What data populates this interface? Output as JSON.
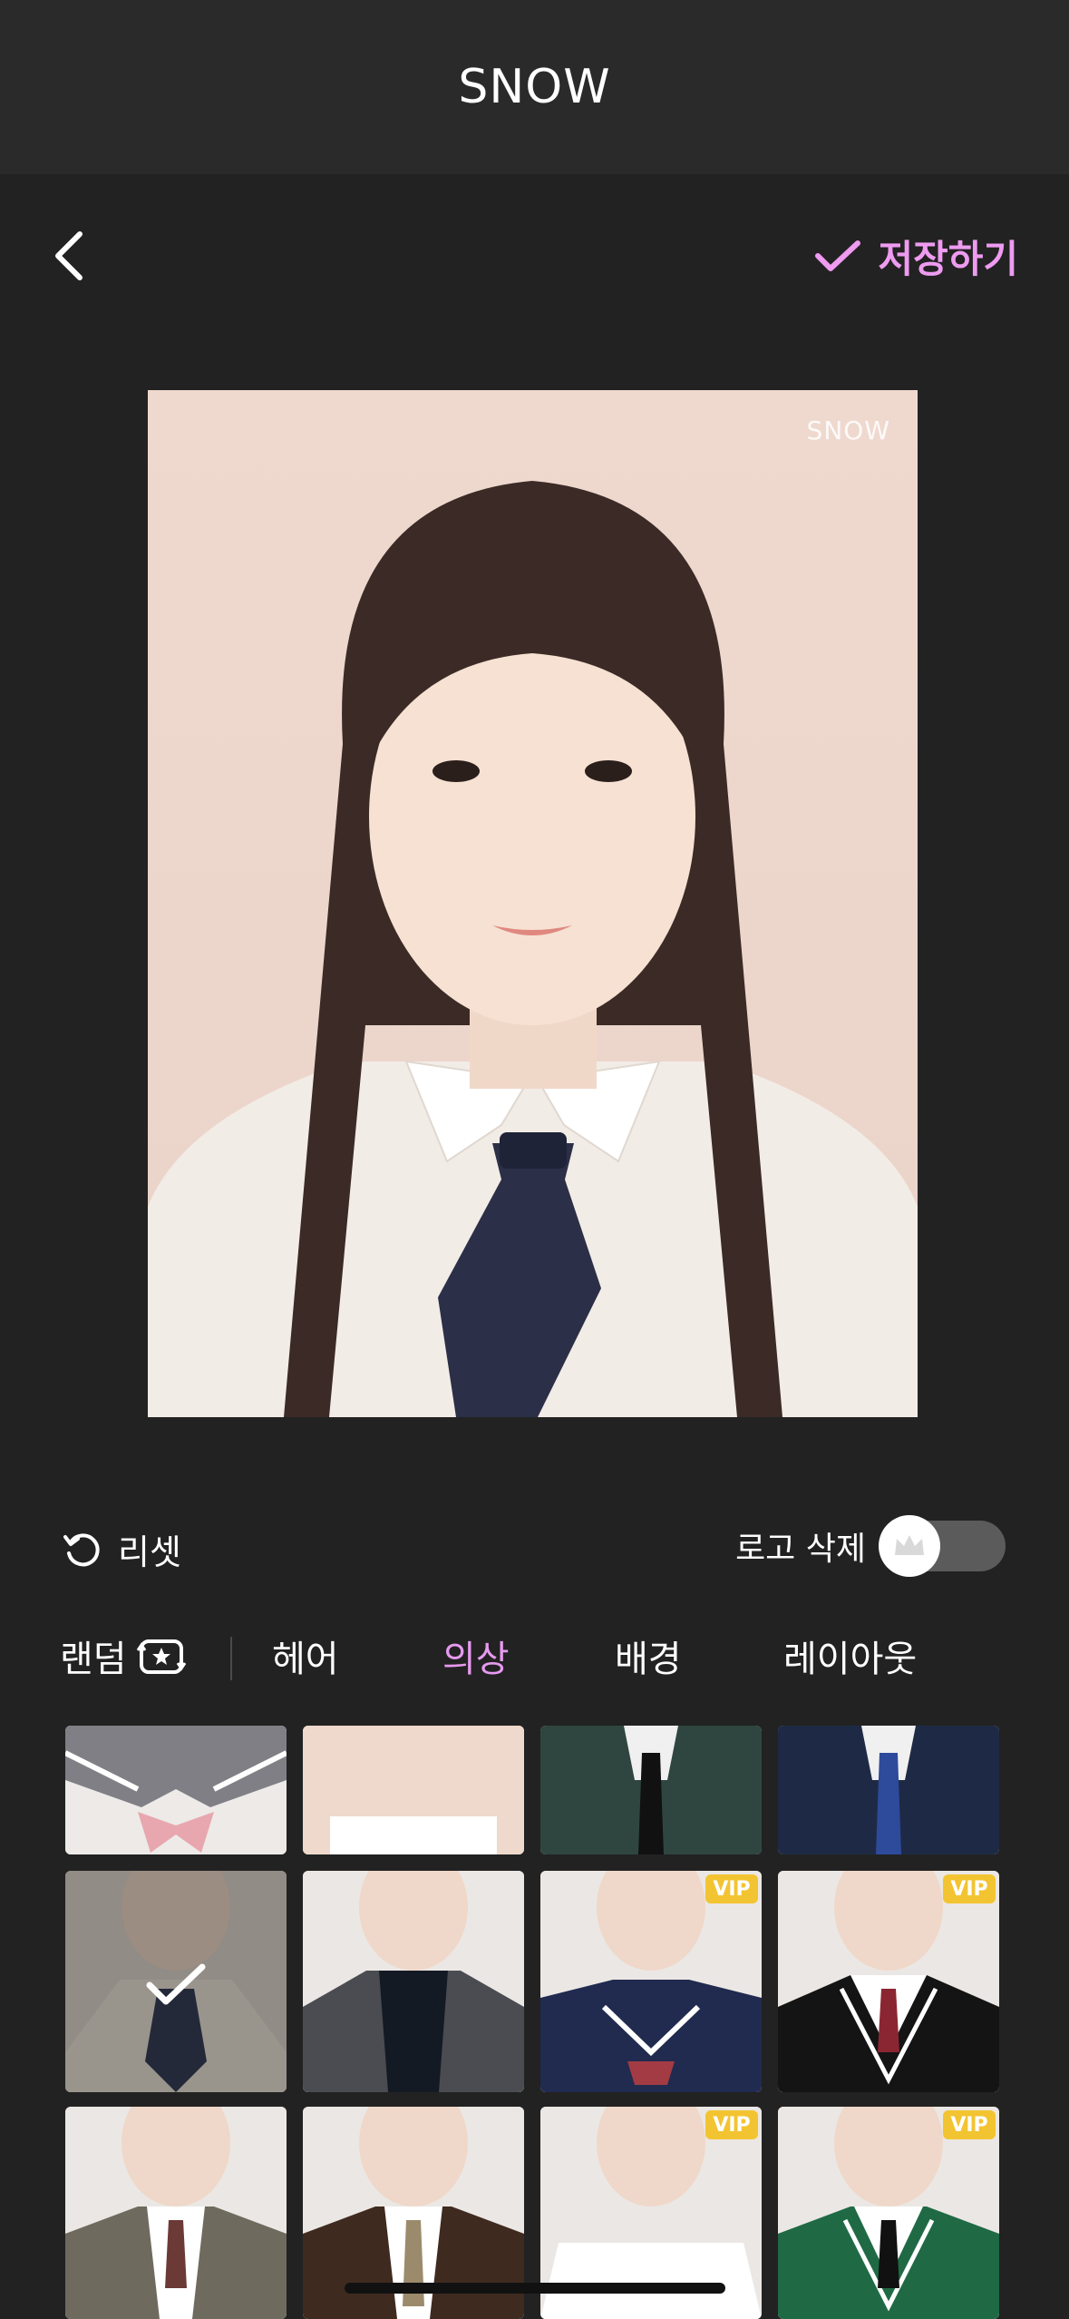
{
  "app": {
    "title": "SNOW"
  },
  "header": {
    "save_label": "저장하기"
  },
  "photo": {
    "watermark": "SNOW"
  },
  "controls": {
    "reset_label": "리셋",
    "logo_remove_label": "로고 삭제",
    "logo_remove_on": false
  },
  "tabs": {
    "random": "랜덤",
    "items": [
      {
        "label": "헤어",
        "active": false
      },
      {
        "label": "의상",
        "active": true
      },
      {
        "label": "배경",
        "active": false
      },
      {
        "label": "레이아웃",
        "active": false
      }
    ]
  },
  "outfits": {
    "vip_label": "VIP",
    "items": [
      {
        "name": "sailor-pink-bow",
        "vip": false,
        "selected": false
      },
      {
        "name": "square-neck",
        "vip": false,
        "selected": false
      },
      {
        "name": "army-uniform",
        "vip": false,
        "selected": false
      },
      {
        "name": "navy-uniform",
        "vip": false,
        "selected": false
      },
      {
        "name": "cream-jabot",
        "vip": false,
        "selected": true
      },
      {
        "name": "grey-blazer-turtleneck",
        "vip": false,
        "selected": false
      },
      {
        "name": "navy-sailor",
        "vip": true,
        "selected": false
      },
      {
        "name": "black-vest-red-tie",
        "vip": true,
        "selected": false
      },
      {
        "name": "olive-jacket-tie",
        "vip": false,
        "selected": false
      },
      {
        "name": "brown-blazer-striped-tie",
        "vip": false,
        "selected": false
      },
      {
        "name": "white-square-neck",
        "vip": true,
        "selected": false
      },
      {
        "name": "green-vest-tie",
        "vip": true,
        "selected": false
      }
    ]
  },
  "colors": {
    "accent": "#e79af0",
    "background": "#222222",
    "vip": "#f3c431"
  }
}
